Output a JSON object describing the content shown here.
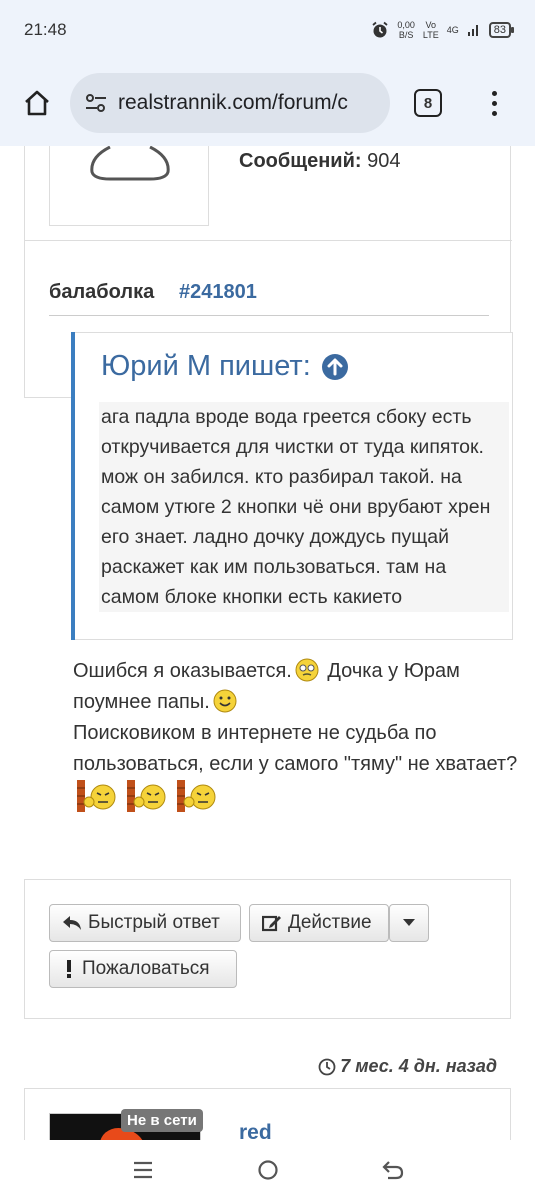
{
  "status_bar": {
    "time": "21:48",
    "net_speed_value": "0,00",
    "net_speed_unit": "B/S",
    "volte_top": "Vo",
    "volte_bottom": "LTE",
    "network": "4G",
    "battery": "83"
  },
  "browser": {
    "url": "realstrannik.com/forum/c",
    "tab_count": "8"
  },
  "profile": {
    "messages_label": "Сообщений:",
    "messages_count": "904"
  },
  "post": {
    "title": "балаболка",
    "number": "#241801",
    "quote_title": "Юрий М пишет:",
    "quote_text": "ага падла вроде вода греется сбоку есть откручивается для чистки от туда кипяток. мож он забился. кто разбирал такой. на самом утюге 2 кнопки чё они врубают хрен его знает. ладно дочку дождусь пущай раскажет как им пользоваться. там на самом блоке кнопки есть какието",
    "body_line1": "Ошибся я оказывается.",
    "body_line2": " Дочка у Юрам поумнее папы.",
    "body_line3": "Поисковиком в интернете не судьба по пользоваться, если у самого \"тяму\" не хватает?"
  },
  "actions": {
    "quick_reply": "Быстрый ответ",
    "action": "Действие",
    "report": "Пожаловаться"
  },
  "next_post": {
    "time_ago": "7 мес. 4 дн. назад",
    "offline_badge": "Не в сети",
    "username": "red"
  },
  "colors": {
    "accent": "#3b6aa0",
    "quote_border": "#3b7ec0",
    "stars": "#f08a3a"
  }
}
